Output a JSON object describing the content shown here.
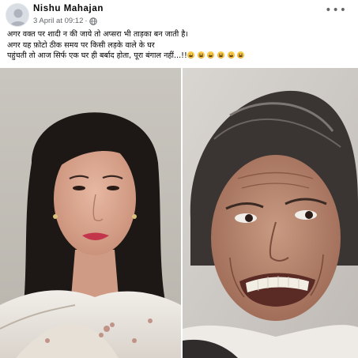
{
  "post": {
    "author": "Nishu Mahajan",
    "timestamp": "3 April at 09:12",
    "privacy_icon": "globe-icon",
    "more_icon": "more-options-icon",
    "more_label": "•••",
    "caption_lines": [
      "अगर वक्त पर शादी न की जाये तो अप्सरा भी ताड़का बन जाती है।",
      "अगर यह फ़ोटो ठीक समय पर किसी लड़के वाले के घर",
      "पहुंचती तो आज सिर्फ एक घर ही बर्बाद होता, पूरा बंगाल नहीं...!!"
    ],
    "emoji_count": 6,
    "photos": [
      {
        "name": "left-photo",
        "description_icon": "young-woman-portrait-image"
      },
      {
        "name": "right-photo",
        "description_icon": "older-woman-grimace-image"
      }
    ]
  },
  "colors": {
    "text": "#050505",
    "secondary_text": "#65676b",
    "background": "#ffffff"
  }
}
